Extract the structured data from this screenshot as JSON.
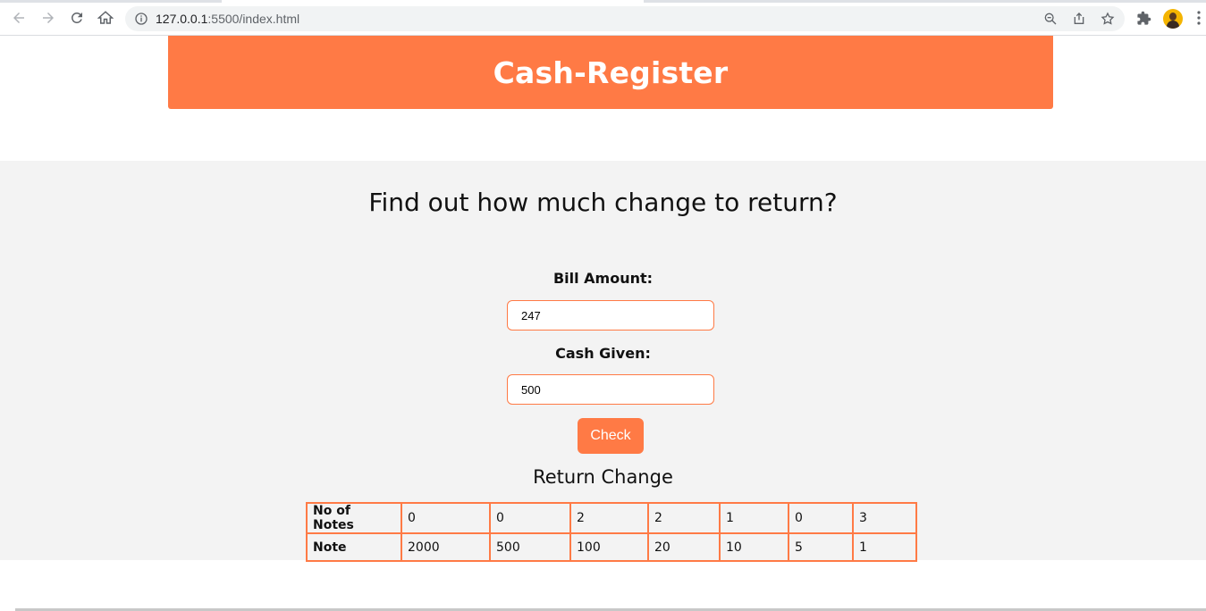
{
  "browser": {
    "url_host": "127.0.0.1",
    "url_path": ":5500/index.html"
  },
  "header": {
    "title": "Cash-Register"
  },
  "main": {
    "subtitle": "Find out how much change to return?",
    "bill_label": "Bill Amount:",
    "bill_value": "247",
    "cash_label": "Cash Given:",
    "cash_value": "500",
    "check_label": "Check",
    "return_title": "Return Change"
  },
  "table": {
    "row_notes_label": "No of Notes",
    "row_note_label": "Note",
    "counts": [
      "0",
      "0",
      "2",
      "2",
      "1",
      "0",
      "3"
    ],
    "notes": [
      "2000",
      "500",
      "100",
      "20",
      "10",
      "5",
      "1"
    ]
  },
  "colors": {
    "accent": "#ff7a45",
    "panel_bg": "#f3f3f3"
  }
}
